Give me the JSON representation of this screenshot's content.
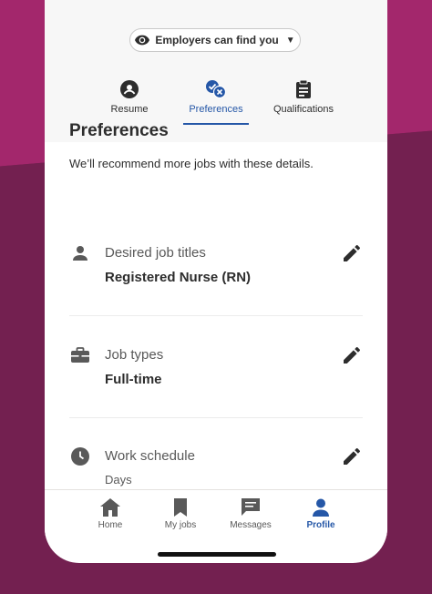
{
  "visibility": {
    "label": "Employers can find you",
    "caret": "▼"
  },
  "tabs": [
    {
      "label": "Resume",
      "icon": "person-circle-icon"
    },
    {
      "label": "Preferences",
      "icon": "preferences-check-x-icon",
      "active": true
    },
    {
      "label": "Qualifications",
      "icon": "clipboard-icon"
    }
  ],
  "section": {
    "title": "Preferences",
    "subtitle": "We’ll recommend more jobs with these details."
  },
  "preferences": [
    {
      "label": "Desired job titles",
      "value": "Registered Nurse (RN)",
      "icon": "person-icon"
    },
    {
      "label": "Job types",
      "value": "Full-time",
      "icon": "briefcase-icon"
    },
    {
      "label": "Work schedule",
      "value": "Days",
      "icon": "clock-icon"
    }
  ],
  "nav": [
    {
      "label": "Home",
      "icon": "home-icon"
    },
    {
      "label": "My jobs",
      "icon": "bookmark-icon"
    },
    {
      "label": "Messages",
      "icon": "message-icon"
    },
    {
      "label": "Profile",
      "icon": "profile-icon",
      "active": true
    }
  ],
  "colors": {
    "accent": "#2557a7",
    "background_top": "#a3276c",
    "background_bottom": "#732050"
  }
}
